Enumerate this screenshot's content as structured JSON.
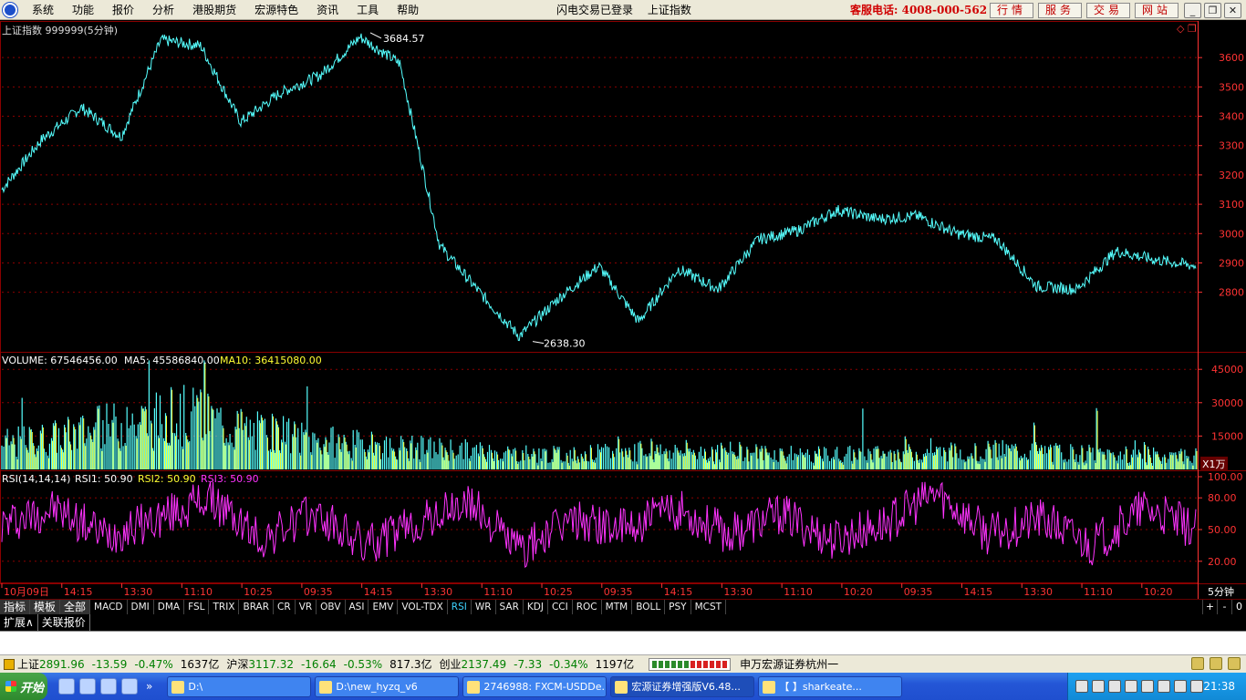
{
  "menu": {
    "items": [
      "系统",
      "功能",
      "报价",
      "分析",
      "港股期货",
      "宏源特色",
      "资讯",
      "工具",
      "帮助"
    ],
    "status_login": "闪电交易已登录",
    "status_index": "上证指数",
    "hotline": "客服电话: 4008-000-562",
    "buttons": [
      "行情",
      "服务",
      "交易",
      "网站"
    ]
  },
  "chart": {
    "title": "上证指数 999999(5分钟)",
    "max_label": "3684.57",
    "min_label": "2638.30",
    "price_axis": [
      "3600",
      "3500",
      "3400",
      "3300",
      "3200",
      "3100",
      "3000",
      "2900",
      "2800"
    ],
    "volume_label": "VOLUME: 67546456.00",
    "ma5_label": "MA5: 45586840.00",
    "ma10_label": "MA10: 36415080.00",
    "volume_axis": [
      "45000",
      "30000",
      "15000"
    ],
    "volume_unit": "X1万",
    "rsi_label": "RSI(14,14,14)",
    "rsi1_label": "RSI1: 50.90",
    "rsi2_label": "RSI2: 50.90",
    "rsi3_label": "RSI3: 50.90",
    "rsi_axis": [
      "100.00",
      "80.00",
      "50.00",
      "20.00"
    ],
    "time_axis": [
      "10月09日",
      "14:15",
      "13:30",
      "11:10",
      "10:25",
      "09:35",
      "14:15",
      "13:30",
      "11:10",
      "10:25",
      "09:35",
      "14:15",
      "13:30",
      "11:10",
      "10:20",
      "09:35",
      "14:15",
      "13:30",
      "11:10",
      "10:20"
    ],
    "period": "5分钟",
    "colors": {
      "up": "#ff3333",
      "down": "#55ffff",
      "grid": "#8a0000",
      "axis": "#ff3333",
      "volume_yellow": "#ffff33",
      "rsi": "#ff33ff"
    }
  },
  "chart_data": [
    {
      "type": "line",
      "title": "上证指数 999999(5分钟)",
      "xlabel": "",
      "ylabel": "",
      "ylim": [
        2600,
        3700
      ],
      "x": [
        "10月09日",
        "14:15",
        "13:30",
        "11:10",
        "10:25",
        "09:35",
        "14:15",
        "13:30",
        "11:10",
        "10:25",
        "09:35",
        "14:15",
        "13:30",
        "11:10",
        "10:20",
        "09:35",
        "14:15",
        "13:30",
        "11:10",
        "10:20"
      ],
      "series": [
        {
          "name": "",
          "values": [
            3150,
            3320,
            3430,
            3330,
            3660,
            3640,
            3380,
            3480,
            3540,
            3670,
            3580,
            2960,
            2800,
            2650,
            2780,
            2890,
            2700,
            2880,
            2810,
            2980,
            3010,
            3080,
            3050,
            3060,
            3000,
            2980,
            2820,
            2810,
            2940,
            2910,
            2890
          ]
        }
      ],
      "annotations": [
        "3684.57",
        "2638.30"
      ]
    },
    {
      "type": "bar",
      "title": "VOLUME",
      "ylim": [
        0,
        50000
      ],
      "unit": "X1万",
      "series": [
        {
          "name": "VOLUME",
          "values": [
            12000,
            16000,
            22000,
            26000,
            18000,
            14000,
            11000,
            10000,
            8000,
            7000,
            8500,
            9000,
            8000,
            7000,
            7500,
            8000,
            9000,
            8000,
            7000,
            6500
          ]
        },
        {
          "name": "MA5",
          "values": [
            10000,
            13000,
            17000,
            20000,
            17000,
            13000,
            10000,
            9000,
            7500,
            7000,
            7500,
            8000,
            7500,
            7000,
            7000,
            7500,
            8000,
            7500,
            7000,
            6500
          ]
        },
        {
          "name": "MA10",
          "values": [
            8000,
            10000,
            13000,
            15000,
            14000,
            12000,
            10000,
            8500,
            7500,
            7000,
            7000,
            7500,
            7200,
            7000,
            7000,
            7200,
            7500,
            7200,
            7000,
            6600
          ]
        }
      ]
    },
    {
      "type": "line",
      "title": "RSI(14,14,14)",
      "ylim": [
        0,
        100
      ],
      "series": [
        {
          "name": "RSI1",
          "values": [
            55,
            70,
            45,
            60,
            80,
            40,
            65,
            35,
            55,
            75,
            30,
            60,
            50,
            70,
            45,
            65,
            40,
            55,
            85,
            45,
            60,
            35,
            70,
            50
          ]
        }
      ]
    }
  ],
  "indicators": {
    "main_tabs": [
      "指标",
      "模板",
      "全部"
    ],
    "items": [
      "MACD",
      "DMI",
      "DMA",
      "FSL",
      "TRIX",
      "BRAR",
      "CR",
      "VR",
      "OBV",
      "ASI",
      "EMV",
      "VOL-TDX",
      "RSI",
      "WR",
      "SAR",
      "KDJ",
      "CCI",
      "ROC",
      "MTM",
      "BOLL",
      "PSY",
      "MCST"
    ],
    "active": "RSI",
    "right": [
      "+",
      "-",
      "0"
    ]
  },
  "ext_tabs": [
    "扩展∧",
    "关联报价"
  ],
  "ticker": {
    "sh_name": "上证",
    "sh_val": "2891.96",
    "sh_chg": "-13.59",
    "sh_pct": "-0.47%",
    "sh_amt": "1637亿",
    "hs_name": "沪深",
    "hs_val": "3117.32",
    "hs_chg": "-16.64",
    "hs_pct": "-0.53%",
    "hs_amt": "817.3亿",
    "cy_name": "创业",
    "cy_val": "2137.49",
    "cy_chg": "-7.33",
    "cy_pct": "-0.34%",
    "cy_amt": "1197亿",
    "broker": "申万宏源证券杭州一"
  },
  "taskbar": {
    "start": "开始",
    "more": "»",
    "tasks": [
      "D:\\",
      "D:\\new_hyzq_v6",
      "2746988: FXCM-USDDe...",
      "宏源证券增强版V6.48...",
      "【        】sharkeate..."
    ],
    "clock": "21:38"
  }
}
